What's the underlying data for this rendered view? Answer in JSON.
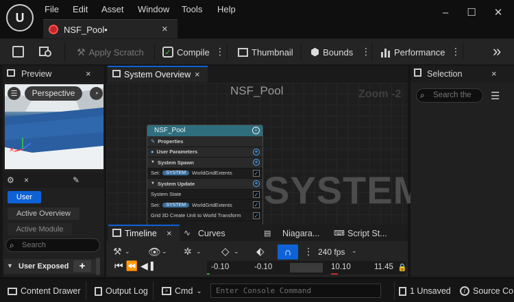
{
  "menu": {
    "items": [
      "File",
      "Edit",
      "Asset",
      "Window",
      "Tools",
      "Help"
    ]
  },
  "window_controls": {
    "minimize": "–",
    "maximize": "☐",
    "close": "✕"
  },
  "doc_tab": {
    "label": "NSF_Pool•",
    "close": "×"
  },
  "toolbar": {
    "apply_scratch": "Apply Scratch",
    "compile": "Compile",
    "thumbnail": "Thumbnail",
    "bounds": "Bounds",
    "performance": "Performance",
    "more": "»"
  },
  "preview_panel": {
    "tab_label": "Preview",
    "view_mode": "Perspective",
    "user_btn": "User",
    "active_overview_btn": "Active Overview",
    "active_module_btn": "Active Module",
    "search_placeholder": "Search",
    "user_exposed_label": "User Exposed"
  },
  "system_overview": {
    "tab_label": "System Overview",
    "graph_title": "NSF_Pool",
    "zoom_label": "Zoom -2",
    "watermark": "SYSTEM",
    "node": {
      "title": "NSF_Pool",
      "properties": "Properties",
      "user_parameters": "User Parameters",
      "system_spawn": "System Spawn",
      "set_label": "Set:",
      "system_pill": "SYSTEM",
      "world_grid_extents": "WorldGridExtents",
      "system_update": "System Update",
      "system_state": "System State",
      "grid_create_unit": "Grid 3D Create Unit to World Transform"
    }
  },
  "selection_panel": {
    "tab_label": "Selection",
    "search_placeholder": "Search the"
  },
  "bottom_tabs": {
    "timeline": "Timeline",
    "curves": "Curves",
    "niagara": "Niagara...",
    "script_stats": "Script St..."
  },
  "timeline": {
    "fps_label": "240 fps",
    "values": [
      "-0.10",
      "-0.10",
      "10.10",
      "11.45"
    ]
  },
  "statusbar": {
    "content_drawer": "Content Drawer",
    "output_log": "Output Log",
    "cmd": "Cmd",
    "console_placeholder": "Enter Console Command",
    "unsaved": "1 Unsaved",
    "source_control": "Source Co"
  },
  "colors": {
    "accent_blue": "#0e62d6",
    "node_header": "#2f6e7d",
    "record_red": "#cc2b2b"
  }
}
